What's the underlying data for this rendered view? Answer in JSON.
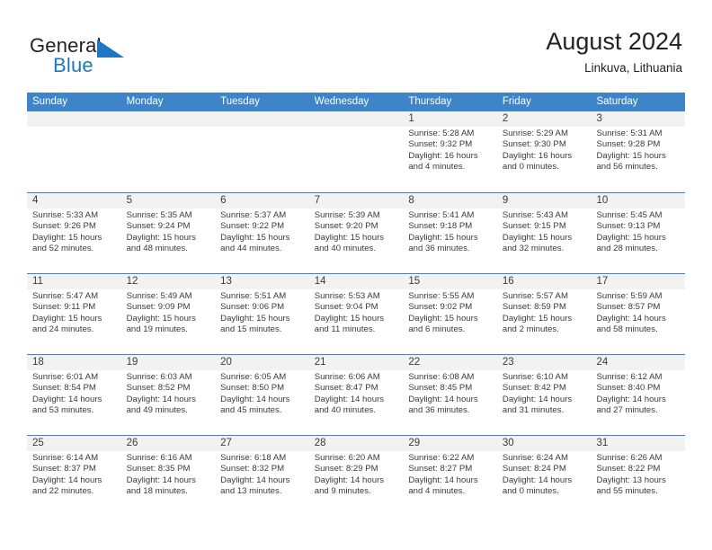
{
  "brand": {
    "name_part1": "General",
    "name_part2": "Blue",
    "logo_icon": "triangle-logo-icon"
  },
  "header": {
    "title": "August 2024",
    "subtitle": "Linkuva, Lithuania"
  },
  "weekday_headers": [
    "Sunday",
    "Monday",
    "Tuesday",
    "Wednesday",
    "Thursday",
    "Friday",
    "Saturday"
  ],
  "colors": {
    "header_blue": "#3d85c8",
    "brand_blue": "#1f77c4",
    "day_shade": "#f2f2f2",
    "text": "#3a3a3a"
  },
  "weeks": [
    [
      {
        "blank": true
      },
      {
        "blank": true
      },
      {
        "blank": true
      },
      {
        "blank": true
      },
      {
        "day": "1",
        "sunrise": "Sunrise: 5:28 AM",
        "sunset": "Sunset: 9:32 PM",
        "daylight1": "Daylight: 16 hours",
        "daylight2": "and 4 minutes."
      },
      {
        "day": "2",
        "sunrise": "Sunrise: 5:29 AM",
        "sunset": "Sunset: 9:30 PM",
        "daylight1": "Daylight: 16 hours",
        "daylight2": "and 0 minutes."
      },
      {
        "day": "3",
        "sunrise": "Sunrise: 5:31 AM",
        "sunset": "Sunset: 9:28 PM",
        "daylight1": "Daylight: 15 hours",
        "daylight2": "and 56 minutes."
      }
    ],
    [
      {
        "day": "4",
        "sunrise": "Sunrise: 5:33 AM",
        "sunset": "Sunset: 9:26 PM",
        "daylight1": "Daylight: 15 hours",
        "daylight2": "and 52 minutes."
      },
      {
        "day": "5",
        "sunrise": "Sunrise: 5:35 AM",
        "sunset": "Sunset: 9:24 PM",
        "daylight1": "Daylight: 15 hours",
        "daylight2": "and 48 minutes."
      },
      {
        "day": "6",
        "sunrise": "Sunrise: 5:37 AM",
        "sunset": "Sunset: 9:22 PM",
        "daylight1": "Daylight: 15 hours",
        "daylight2": "and 44 minutes."
      },
      {
        "day": "7",
        "sunrise": "Sunrise: 5:39 AM",
        "sunset": "Sunset: 9:20 PM",
        "daylight1": "Daylight: 15 hours",
        "daylight2": "and 40 minutes."
      },
      {
        "day": "8",
        "sunrise": "Sunrise: 5:41 AM",
        "sunset": "Sunset: 9:18 PM",
        "daylight1": "Daylight: 15 hours",
        "daylight2": "and 36 minutes."
      },
      {
        "day": "9",
        "sunrise": "Sunrise: 5:43 AM",
        "sunset": "Sunset: 9:15 PM",
        "daylight1": "Daylight: 15 hours",
        "daylight2": "and 32 minutes."
      },
      {
        "day": "10",
        "sunrise": "Sunrise: 5:45 AM",
        "sunset": "Sunset: 9:13 PM",
        "daylight1": "Daylight: 15 hours",
        "daylight2": "and 28 minutes."
      }
    ],
    [
      {
        "day": "11",
        "sunrise": "Sunrise: 5:47 AM",
        "sunset": "Sunset: 9:11 PM",
        "daylight1": "Daylight: 15 hours",
        "daylight2": "and 24 minutes."
      },
      {
        "day": "12",
        "sunrise": "Sunrise: 5:49 AM",
        "sunset": "Sunset: 9:09 PM",
        "daylight1": "Daylight: 15 hours",
        "daylight2": "and 19 minutes."
      },
      {
        "day": "13",
        "sunrise": "Sunrise: 5:51 AM",
        "sunset": "Sunset: 9:06 PM",
        "daylight1": "Daylight: 15 hours",
        "daylight2": "and 15 minutes."
      },
      {
        "day": "14",
        "sunrise": "Sunrise: 5:53 AM",
        "sunset": "Sunset: 9:04 PM",
        "daylight1": "Daylight: 15 hours",
        "daylight2": "and 11 minutes."
      },
      {
        "day": "15",
        "sunrise": "Sunrise: 5:55 AM",
        "sunset": "Sunset: 9:02 PM",
        "daylight1": "Daylight: 15 hours",
        "daylight2": "and 6 minutes."
      },
      {
        "day": "16",
        "sunrise": "Sunrise: 5:57 AM",
        "sunset": "Sunset: 8:59 PM",
        "daylight1": "Daylight: 15 hours",
        "daylight2": "and 2 minutes."
      },
      {
        "day": "17",
        "sunrise": "Sunrise: 5:59 AM",
        "sunset": "Sunset: 8:57 PM",
        "daylight1": "Daylight: 14 hours",
        "daylight2": "and 58 minutes."
      }
    ],
    [
      {
        "day": "18",
        "sunrise": "Sunrise: 6:01 AM",
        "sunset": "Sunset: 8:54 PM",
        "daylight1": "Daylight: 14 hours",
        "daylight2": "and 53 minutes."
      },
      {
        "day": "19",
        "sunrise": "Sunrise: 6:03 AM",
        "sunset": "Sunset: 8:52 PM",
        "daylight1": "Daylight: 14 hours",
        "daylight2": "and 49 minutes."
      },
      {
        "day": "20",
        "sunrise": "Sunrise: 6:05 AM",
        "sunset": "Sunset: 8:50 PM",
        "daylight1": "Daylight: 14 hours",
        "daylight2": "and 45 minutes."
      },
      {
        "day": "21",
        "sunrise": "Sunrise: 6:06 AM",
        "sunset": "Sunset: 8:47 PM",
        "daylight1": "Daylight: 14 hours",
        "daylight2": "and 40 minutes."
      },
      {
        "day": "22",
        "sunrise": "Sunrise: 6:08 AM",
        "sunset": "Sunset: 8:45 PM",
        "daylight1": "Daylight: 14 hours",
        "daylight2": "and 36 minutes."
      },
      {
        "day": "23",
        "sunrise": "Sunrise: 6:10 AM",
        "sunset": "Sunset: 8:42 PM",
        "daylight1": "Daylight: 14 hours",
        "daylight2": "and 31 minutes."
      },
      {
        "day": "24",
        "sunrise": "Sunrise: 6:12 AM",
        "sunset": "Sunset: 8:40 PM",
        "daylight1": "Daylight: 14 hours",
        "daylight2": "and 27 minutes."
      }
    ],
    [
      {
        "day": "25",
        "sunrise": "Sunrise: 6:14 AM",
        "sunset": "Sunset: 8:37 PM",
        "daylight1": "Daylight: 14 hours",
        "daylight2": "and 22 minutes."
      },
      {
        "day": "26",
        "sunrise": "Sunrise: 6:16 AM",
        "sunset": "Sunset: 8:35 PM",
        "daylight1": "Daylight: 14 hours",
        "daylight2": "and 18 minutes."
      },
      {
        "day": "27",
        "sunrise": "Sunrise: 6:18 AM",
        "sunset": "Sunset: 8:32 PM",
        "daylight1": "Daylight: 14 hours",
        "daylight2": "and 13 minutes."
      },
      {
        "day": "28",
        "sunrise": "Sunrise: 6:20 AM",
        "sunset": "Sunset: 8:29 PM",
        "daylight1": "Daylight: 14 hours",
        "daylight2": "and 9 minutes."
      },
      {
        "day": "29",
        "sunrise": "Sunrise: 6:22 AM",
        "sunset": "Sunset: 8:27 PM",
        "daylight1": "Daylight: 14 hours",
        "daylight2": "and 4 minutes."
      },
      {
        "day": "30",
        "sunrise": "Sunrise: 6:24 AM",
        "sunset": "Sunset: 8:24 PM",
        "daylight1": "Daylight: 14 hours",
        "daylight2": "and 0 minutes."
      },
      {
        "day": "31",
        "sunrise": "Sunrise: 6:26 AM",
        "sunset": "Sunset: 8:22 PM",
        "daylight1": "Daylight: 13 hours",
        "daylight2": "and 55 minutes."
      }
    ]
  ]
}
